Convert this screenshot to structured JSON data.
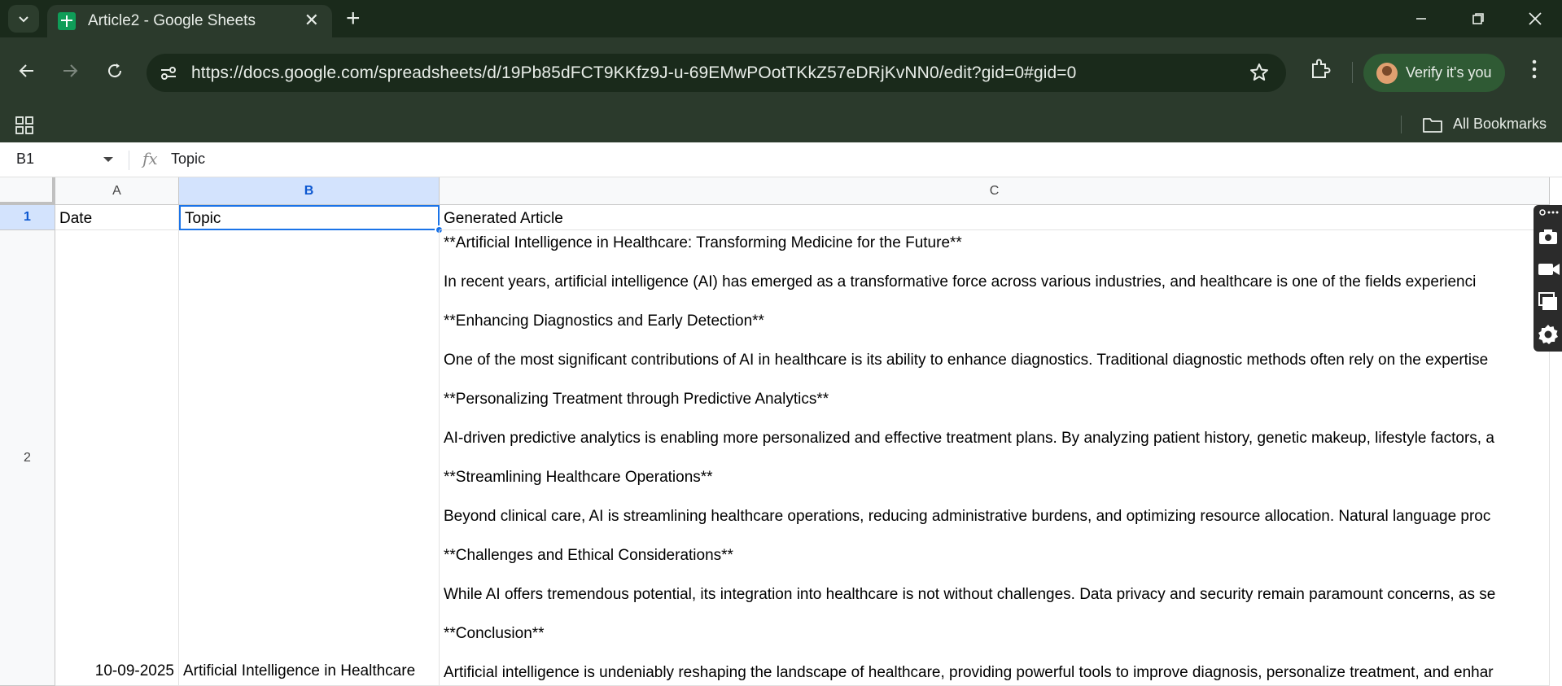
{
  "browser": {
    "tab_title": "Article2 - Google Sheets",
    "url": "https://docs.google.com/spreadsheets/d/19Pb85dFCT9KKfz9J-u-69EMwPOotTKkZ57eDRjKvNN0/edit?gid=0#gid=0",
    "profile_label": "Verify it's you",
    "bookmarks_label": "All Bookmarks"
  },
  "formula_bar": {
    "cell_ref": "B1",
    "fx": "fx",
    "value": "Topic"
  },
  "sheet": {
    "columns": [
      "A",
      "B",
      "C"
    ],
    "rows": [
      "1",
      "2"
    ],
    "header_row": {
      "a": "Date",
      "b": "Topic",
      "c": "Generated Article"
    },
    "row2": {
      "a": "10-09-2025",
      "b": "Artificial Intelligence  in Healthcare",
      "article_lines": [
        "**Artificial Intelligence in Healthcare: Transforming Medicine for the Future**",
        "In recent years, artificial intelligence (AI) has emerged as a transformative force across various industries, and healthcare is one of the fields experienci",
        "**Enhancing Diagnostics and Early Detection**",
        "One of the most significant contributions of AI in healthcare is its ability to enhance diagnostics. Traditional diagnostic methods often rely on the expertise",
        "**Personalizing Treatment through Predictive Analytics**",
        "AI-driven predictive analytics is enabling more personalized and effective treatment plans. By analyzing patient history, genetic makeup, lifestyle factors, a",
        "**Streamlining Healthcare Operations**",
        "Beyond clinical care, AI is streamlining healthcare operations, reducing administrative burdens, and optimizing resource allocation. Natural language proc",
        "**Challenges and Ethical Considerations**",
        "While AI offers tremendous potential, its integration into healthcare is not without challenges. Data privacy and security remain paramount concerns, as se",
        "**Conclusion**",
        "Artificial intelligence is undeniably reshaping the landscape of healthcare, providing powerful tools to improve diagnosis, personalize treatment, and enhar"
      ]
    }
  },
  "colors": {
    "titlebar": "#1a2a1b",
    "toolbar": "#2b3a2c",
    "selection": "#1a73e8",
    "selected_header": "#d3e3fd"
  }
}
